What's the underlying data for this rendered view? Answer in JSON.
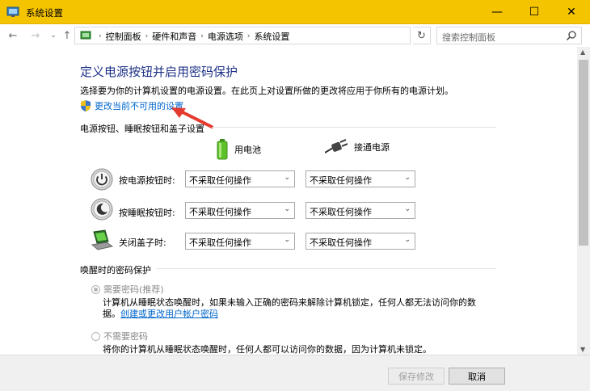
{
  "window": {
    "title": "系统设置",
    "controls": {
      "minimize": "—",
      "maximize": "☐",
      "close": "✕"
    }
  },
  "address_bar": {
    "breadcrumbs": [
      "控制面板",
      "硬件和声音",
      "电源选项",
      "系统设置"
    ],
    "search_placeholder": "搜索控制面板"
  },
  "main": {
    "title": "定义电源按钮并启用密码保护",
    "intro": "选择要为你的计算机设置的电源设置。在此页上对设置所做的更改将应用于你所有的电源计划。",
    "change_link": "更改当前不可用的设置",
    "power_section": {
      "heading": "电源按钮、睡眠按钮和盖子设置",
      "col_battery": "用电池",
      "col_plugged": "接通电源",
      "rows": [
        {
          "label": "按电源按钮时:",
          "battery": "不采取任何操作",
          "plugged": "不采取任何操作",
          "icon": "power-button-icon"
        },
        {
          "label": "按睡眠按钮时:",
          "battery": "不采取任何操作",
          "plugged": "不采取任何操作",
          "icon": "sleep-button-icon"
        },
        {
          "label": "关闭盖子时:",
          "battery": "不采取任何操作",
          "plugged": "不采取任何操作",
          "icon": "laptop-lid-icon"
        }
      ]
    },
    "wake_section": {
      "heading": "唤醒时的密码保护",
      "option_require": "需要密码(推荐)",
      "option_require_desc": "计算机从睡眠状态唤醒时，如果未输入正确的密码来解除计算机锁定，任何人都无法访问你的数",
      "option_require_desc2": "据。",
      "option_require_link": "创建或更改用户帐户密码",
      "option_none": "不需要密码",
      "option_none_desc": "将你的计算机从睡眠状态唤醒时，任何人都可以访问你的数据，因为计算机未锁定。",
      "selected": "需要密码(推荐)"
    }
  },
  "footer": {
    "save_label": "保存修改",
    "cancel_label": "取消"
  },
  "colors": {
    "title_bar": "#f5c400",
    "title_text": "#1e3287",
    "link": "#0066cc",
    "annotation_arrow": "#e53a2f"
  }
}
